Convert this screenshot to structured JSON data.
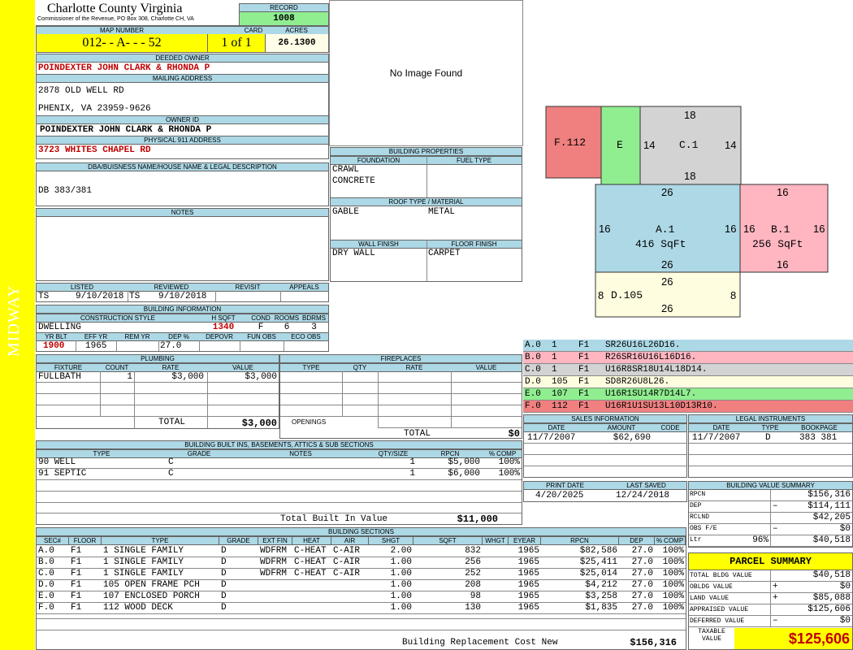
{
  "sidebar": {
    "text": "MIDWAY"
  },
  "header": {
    "county": "Charlotte County Virginia",
    "office": "Commissioner of the Revenue, PO Box 308, Charlotte CH, VA",
    "record_label": "RECORD",
    "record": "1008",
    "map_number_label": "MAP NUMBER",
    "map_number": "012- - A- - - 52",
    "card_label": "CARD",
    "card": "1 of 1",
    "acres_label": "ACRES",
    "acres": "26.1300"
  },
  "owner": {
    "deeded_label": "DEEDED OWNER",
    "deeded": "POINDEXTER JOHN CLARK & RHONDA P",
    "mailing_label": "MAILING ADDRESS",
    "mailing1": "2878 OLD WELL RD",
    "mailing2": "PHENIX, VA 23959-9626",
    "owner_id_label": "OWNER ID",
    "owner_id": "POINDEXTER JOHN CLARK & RHONDA P",
    "physical_label": "PHYSICAL 911 ADDRESS",
    "physical": "3723 WHITES CHAPEL RD",
    "dba_label": "DBA/BUISNESS NAME/HOUSE NAME & LEGAL DESCRIPTION",
    "dba": "DB 383/381",
    "notes_label": "NOTES"
  },
  "image": {
    "placeholder": "No Image Found"
  },
  "building_props": {
    "title": "BUILDING PROPERTIES",
    "foundation_label": "FOUNDATION",
    "fuel_label": "FUEL TYPE",
    "foundation1": "CRAWL",
    "foundation2": "CONCRETE",
    "roof_label": "ROOF TYPE / MATERIAL",
    "roof_type": "GABLE",
    "roof_material": "METAL",
    "wall_label": "WALL FINISH",
    "floor_label": "FLOOR FINISH",
    "wall": "DRY WALL",
    "floor": "CARPET"
  },
  "review": {
    "listed_label": "LISTED",
    "reviewed_label": "REVIEWED",
    "revisit_label": "REVISIT",
    "appeals_label": "APPEALS",
    "listed_by": "TS",
    "listed_date": "9/10/2018",
    "reviewed_by": "TS",
    "reviewed_date": "9/10/2018"
  },
  "building_info": {
    "title": "BUILDING INFORMATION",
    "style_label": "CONSTRUCTION STYLE",
    "hsqft_label": "H SQFT",
    "cond_label": "COND",
    "rooms_label": "ROOMS",
    "bdrms_label": "BDRMS",
    "style": "DWELLING",
    "hsqft": "1340",
    "cond": "F",
    "rooms": "6",
    "bdrms": "3",
    "yrblt_label": "YR BLT",
    "effyr_label": "EFF YR",
    "remyr_label": "REM YR",
    "dep_label": "DEP %",
    "depovr_label": "DEPOVR",
    "funobs_label": "FUN OBS",
    "ecoobs_label": "ECO OBS",
    "yrblt": "1900",
    "effyr": "1965",
    "dep": "27.0"
  },
  "plumbing": {
    "title": "PLUMBING",
    "headers": [
      "FIXTURE",
      "COUNT",
      "RATE",
      "VALUE"
    ],
    "rows": [
      [
        "FULLBATH",
        "1",
        "$3,000",
        "$3,000"
      ]
    ],
    "total_label": "TOTAL",
    "total": "$3,000"
  },
  "fireplaces": {
    "title": "FIREPLACES",
    "headers": [
      "TYPE",
      "QTY",
      "RATE",
      "VALUE"
    ],
    "openings_label": "OPENINGS",
    "total_label": "TOTAL",
    "total": "$0"
  },
  "builtins": {
    "title": "BUILDING BUILT INS, BASEMENTS, ATTICS & SUB SECTIONS",
    "headers": [
      "TYPE",
      "GRADE",
      "NOTES",
      "QTY/SIZE",
      "RPCN",
      "% COMP"
    ],
    "rows": [
      [
        "90 WELL",
        "C",
        "",
        "1",
        "$5,000",
        "100%"
      ],
      [
        "91 SEPTIC",
        "C",
        "",
        "1",
        "$6,000",
        "100%"
      ]
    ],
    "total_label": "Total Built In Value",
    "total": "$11,000"
  },
  "sketch": {
    "sections": [
      {
        "label": "F.112",
        "color": "#f08080"
      },
      {
        "label": "E",
        "color": "#90ee90"
      },
      {
        "label": "C.1",
        "color": "#d3d3d3"
      },
      {
        "label": "A.1",
        "area": "416 SqFt",
        "color": "#add8e6"
      },
      {
        "label": "B.1",
        "area": "256 SqFt",
        "color": "#ffb6c1"
      },
      {
        "label": "D.105",
        "color": "#fffde0"
      }
    ],
    "dims": {
      "c_top": "18",
      "c_bottom": "18",
      "c_left": "14",
      "c_right": "14",
      "a_top": "26",
      "a_bottom": "26",
      "a_left": "16",
      "a_right": "16",
      "b_top": "16",
      "b_bottom": "16",
      "b_left": "16",
      "b_right": "16",
      "d_top": "26",
      "d_bottom": "26",
      "d_left": "8",
      "d_right": "8"
    }
  },
  "sketch_legend": [
    {
      "text": "A.0  1    F1   SR26U16L26D16.",
      "color": "#add8e6"
    },
    {
      "text": "B.0  1    F1   R26SR16U16L16D16.",
      "color": "#ffb6c1"
    },
    {
      "text": "C.0  1    F1   U16R8SR18U14L18D14.",
      "color": "#d3d3d3"
    },
    {
      "text": "D.0  105  F1   SD8R26U8L26.",
      "color": "#fffde0"
    },
    {
      "text": "E.0  107  F1   U16R1SU14R7D14L7.",
      "color": "#90ee90"
    },
    {
      "text": "F.0  112  F1   U16R1U1SU13L10D13R10.",
      "color": "#f08080"
    }
  ],
  "sales": {
    "title": "SALES INFORMATION",
    "headers": [
      "DATE",
      "AMOUNT",
      "CODE"
    ],
    "rows": [
      [
        "11/7/2007",
        "$62,690",
        ""
      ]
    ]
  },
  "legal": {
    "title": "LEGAL INSTRUMENTS",
    "headers": [
      "DATE",
      "TYPE",
      "BOOKPAGE"
    ],
    "rows": [
      [
        "11/7/2007",
        "D",
        "383 381"
      ]
    ]
  },
  "dates": {
    "print_label": "PRINT DATE",
    "print": "4/20/2025",
    "saved_label": "LAST SAVED",
    "saved": "12/24/2018"
  },
  "value_summary": {
    "title": "BUILDING VALUE SUMMARY",
    "rows": [
      {
        "label": "RPCN",
        "pct": "",
        "sign": "",
        "value": "$156,316"
      },
      {
        "label": "DEP",
        "pct": "",
        "sign": "–",
        "value": "$114,111"
      },
      {
        "label": "RCLND",
        "pct": "",
        "sign": "",
        "value": "$42,205"
      },
      {
        "label": "OBS F/E",
        "pct": "",
        "sign": "–",
        "value": "$0"
      },
      {
        "label": "Ltr",
        "pct": "96%",
        "sign": "",
        "value": "$40,518"
      }
    ]
  },
  "parcel_summary": {
    "title": "PARCEL SUMMARY",
    "rows": [
      {
        "label": "TOTAL BLDG VALUE",
        "sign": "",
        "value": "$40,518"
      },
      {
        "label": "OBLDG VALUE",
        "sign": "+",
        "value": "$0"
      },
      {
        "label": "LAND VALUE",
        "sign": "+",
        "value": "$85,088"
      },
      {
        "label": "APPRAISED VALUE",
        "sign": "",
        "value": "$125,606"
      },
      {
        "label": "DEFERRED VALUE",
        "sign": "–",
        "value": "$0"
      }
    ],
    "taxable_label1": "TAXABLE",
    "taxable_label2": "VALUE",
    "taxable": "$125,606"
  },
  "sections": {
    "title": "BUILDING SECTIONS",
    "headers": [
      "SEC#",
      "FLOOR",
      "TYPE",
      "GRADE",
      "EXT FIN",
      "HEAT",
      "AIR",
      "SHGT",
      "SQFT",
      "WHGT",
      "EYEAR",
      "RPCN",
      "DEP",
      "% COMP"
    ],
    "rows": [
      [
        "A.0",
        "F1",
        "1 SINGLE FAMILY",
        "D",
        "WDFRM",
        "C-HEAT",
        "C-AIR",
        "2.00",
        "832",
        "",
        "1965",
        "$82,586",
        "27.0",
        "100%"
      ],
      [
        "B.0",
        "F1",
        "1 SINGLE FAMILY",
        "D",
        "WDFRM",
        "C-HEAT",
        "C-AIR",
        "1.00",
        "256",
        "",
        "1965",
        "$25,411",
        "27.0",
        "100%"
      ],
      [
        "C.0",
        "F1",
        "1 SINGLE FAMILY",
        "D",
        "WDFRM",
        "C-HEAT",
        "C-AIR",
        "1.00",
        "252",
        "",
        "1965",
        "$25,014",
        "27.0",
        "100%"
      ],
      [
        "D.0",
        "F1",
        "105 OPEN FRAME PCH",
        "D",
        "",
        "",
        "",
        "1.00",
        "208",
        "",
        "1965",
        "$4,212",
        "27.0",
        "100%"
      ],
      [
        "E.0",
        "F1",
        "107 ENCLOSED PORCH",
        "D",
        "",
        "",
        "",
        "1.00",
        "98",
        "",
        "1965",
        "$3,258",
        "27.0",
        "100%"
      ],
      [
        "F.0",
        "F1",
        "112 WOOD DECK",
        "D",
        "",
        "",
        "",
        "1.00",
        "130",
        "",
        "1965",
        "$1,835",
        "27.0",
        "100%"
      ]
    ],
    "total_label": "Building Replacement Cost New",
    "total": "$156,316"
  }
}
